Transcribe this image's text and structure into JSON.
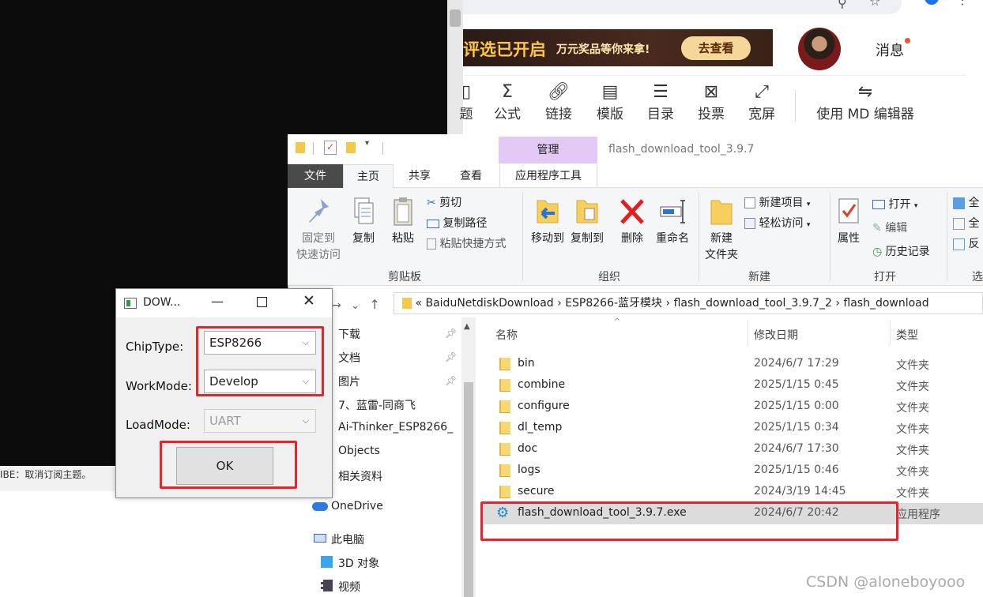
{
  "terminal": {
    "partial_line": "IBE：取消订阅主题。"
  },
  "browser": {
    "banner": {
      "left_text": "评选已开启",
      "middle_text": "万元奖品等你来拿!",
      "button_label": "去查看"
    },
    "messages_label": "消息",
    "toolbar": [
      {
        "icon": "partial-icon",
        "label": "题"
      },
      {
        "icon": "sigma-icon",
        "label": "公式"
      },
      {
        "icon": "link-icon",
        "label": "链接"
      },
      {
        "icon": "template-icon",
        "label": "模版"
      },
      {
        "icon": "toc-icon",
        "label": "目录"
      },
      {
        "icon": "vote-icon",
        "label": "投票"
      },
      {
        "icon": "fullscreen-icon",
        "label": "宽屏"
      },
      {
        "icon": "md-switch-icon",
        "label": "使用 MD 编辑器"
      }
    ]
  },
  "explorer": {
    "window_title": "flash_download_tool_3.9.7",
    "manage_tab": "管理",
    "tabs": {
      "file": "文件",
      "home": "主页",
      "share": "共享",
      "view": "查看",
      "app_tools": "应用程序工具"
    },
    "ribbon": {
      "pin": "固定到\n快速访问",
      "copy": "复制",
      "paste": "粘贴",
      "cut": "剪切",
      "copy_path": "复制路径",
      "paste_shortcut": "粘贴快捷方式",
      "clipboard_group": "剪贴板",
      "move_to": "移动到",
      "copy_to": "复制到",
      "delete": "删除",
      "rename": "重命名",
      "organize_group": "组织",
      "new_folder": "新建\n文件夹",
      "new_item": "新建项目",
      "easy_access": "轻松访问",
      "new_group": "新建",
      "properties": "属性",
      "open": "打开",
      "edit": "编辑",
      "history": "历史记录",
      "open_group": "打开",
      "select_all_partial": "全",
      "select_none_partial": "全",
      "invert_partial": "反",
      "select_group_partial": "选"
    },
    "address": {
      "prefix": "«",
      "segments": [
        "BaiduNetdiskDownload",
        "ESP8266-蓝牙模块",
        "flash_download_tool_3.9.7_2",
        "flash_download"
      ],
      "separator": "›"
    },
    "nav_items": [
      {
        "label": "下载",
        "pinned": true
      },
      {
        "label": "文档",
        "pinned": true
      },
      {
        "label": "图片",
        "pinned": true
      },
      {
        "label": "7、蓝雷-同商飞",
        "pinned": false
      },
      {
        "label": "Ai-Thinker_ESP8266_",
        "pinned": false
      },
      {
        "label": "Objects",
        "pinned": false
      },
      {
        "label": "相关资料",
        "pinned": false
      },
      {
        "label": "OneDrive",
        "pinned": false
      },
      {
        "label": "此电脑",
        "pinned": false
      },
      {
        "label": "3D 对象",
        "pinned": false
      },
      {
        "label": "视频",
        "pinned": false
      }
    ],
    "columns": {
      "name": "名称",
      "date": "修改日期",
      "type": "类型"
    },
    "files": [
      {
        "name": "bin",
        "date": "2024/6/7 17:29",
        "type": "文件夹"
      },
      {
        "name": "combine",
        "date": "2025/1/15 0:45",
        "type": "文件夹"
      },
      {
        "name": "configure",
        "date": "2025/1/15 0:00",
        "type": "文件夹"
      },
      {
        "name": "dl_temp",
        "date": "2025/1/15 0:34",
        "type": "文件夹"
      },
      {
        "name": "doc",
        "date": "2024/6/7 17:30",
        "type": "文件夹"
      },
      {
        "name": "logs",
        "date": "2025/1/15 0:46",
        "type": "文件夹"
      },
      {
        "name": "secure",
        "date": "2024/3/19 14:45",
        "type": "文件夹"
      },
      {
        "name": "flash_download_tool_3.9.7.exe",
        "date": "2024/6/7 20:42",
        "type": "应用程序"
      }
    ]
  },
  "dialog": {
    "title": "DOW...",
    "chip_type_label": "ChipType:",
    "chip_type_value": "ESP8266",
    "work_mode_label": "WorkMode:",
    "work_mode_value": "Develop",
    "load_mode_label": "LoadMode:",
    "load_mode_value": "UART",
    "ok_label": "OK"
  },
  "watermark": "CSDN @aloneboyooo",
  "colors": {
    "highlight_box": "#e8232c",
    "manage_tab": "#e4c8f5",
    "selected_row": "#dcdcdc"
  }
}
